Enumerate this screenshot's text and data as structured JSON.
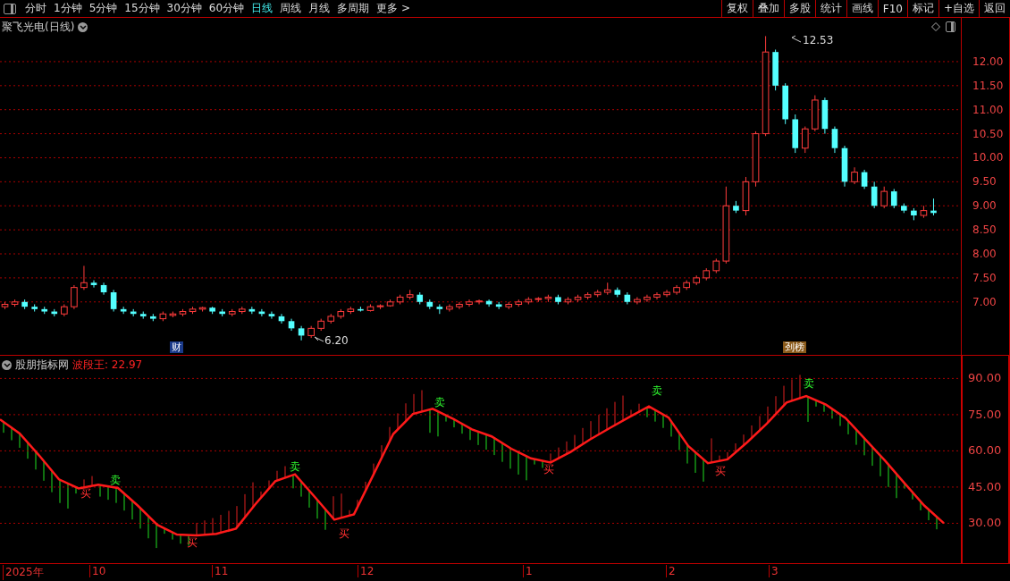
{
  "toolbar": {
    "periods": [
      {
        "label": "分时",
        "selected": false
      },
      {
        "label": "1分钟",
        "selected": false
      },
      {
        "label": "5分钟",
        "selected": false
      },
      {
        "label": "15分钟",
        "selected": false
      },
      {
        "label": "30分钟",
        "selected": false
      },
      {
        "label": "60分钟",
        "selected": false
      },
      {
        "label": "日线",
        "selected": true
      },
      {
        "label": "周线",
        "selected": false
      },
      {
        "label": "月线",
        "selected": false
      },
      {
        "label": "多周期",
        "selected": false
      },
      {
        "label": "更多 >",
        "selected": false
      }
    ],
    "buttons": [
      "复权",
      "叠加",
      "多股",
      "统计",
      "画线",
      "F10",
      "标记",
      "+自选",
      "返回"
    ]
  },
  "main_chart": {
    "title": "聚飞光电(日线)",
    "high_label": "12.53",
    "low_label": "6.20",
    "badges": [
      {
        "text": "财",
        "color": "#1a3a8a"
      },
      {
        "text": "刭榜",
        "color": "#8a5a1a"
      }
    ],
    "chart_data": {
      "type": "candlestick",
      "grid": true,
      "ylim": [
        5.88,
        12.91
      ],
      "yticks": [
        {
          "value": 12,
          "label": "12.00"
        },
        {
          "value": 11.5,
          "label": "11.50"
        },
        {
          "value": 11,
          "label": "11.00"
        },
        {
          "value": 10.5,
          "label": "10.50"
        },
        {
          "value": 10,
          "label": "10.00"
        },
        {
          "value": 9.5,
          "label": "9.50"
        },
        {
          "value": 9,
          "label": "9.00"
        },
        {
          "value": 8.5,
          "label": "8.50"
        },
        {
          "value": 8,
          "label": "8.00"
        },
        {
          "value": 7.5,
          "label": "7.50"
        },
        {
          "value": 7,
          "label": "7.00"
        }
      ],
      "ohlc": [
        [
          6.9,
          7.0,
          6.85,
          6.95
        ],
        [
          6.95,
          7.05,
          6.9,
          7.0
        ],
        [
          7.0,
          7.05,
          6.85,
          6.9
        ],
        [
          6.9,
          6.95,
          6.8,
          6.85
        ],
        [
          6.85,
          6.9,
          6.75,
          6.8
        ],
        [
          6.8,
          6.85,
          6.7,
          6.75
        ],
        [
          6.75,
          6.95,
          6.7,
          6.9
        ],
        [
          6.9,
          7.35,
          6.85,
          7.3
        ],
        [
          7.3,
          7.75,
          7.25,
          7.4
        ],
        [
          7.4,
          7.45,
          7.3,
          7.35
        ],
        [
          7.35,
          7.4,
          7.15,
          7.2
        ],
        [
          7.2,
          7.25,
          6.8,
          6.85
        ],
        [
          6.85,
          6.9,
          6.75,
          6.8
        ],
        [
          6.8,
          6.85,
          6.7,
          6.75
        ],
        [
          6.75,
          6.8,
          6.65,
          6.7
        ],
        [
          6.7,
          6.75,
          6.6,
          6.65
        ],
        [
          6.65,
          6.8,
          6.6,
          6.75
        ],
        [
          6.72,
          6.8,
          6.68,
          6.75
        ],
        [
          6.75,
          6.85,
          6.7,
          6.8
        ],
        [
          6.8,
          6.9,
          6.75,
          6.85
        ],
        [
          6.85,
          6.9,
          6.8,
          6.88
        ],
        [
          6.88,
          6.9,
          6.75,
          6.8
        ],
        [
          6.8,
          6.85,
          6.7,
          6.75
        ],
        [
          6.75,
          6.85,
          6.7,
          6.8
        ],
        [
          6.8,
          6.9,
          6.75,
          6.85
        ],
        [
          6.85,
          6.9,
          6.75,
          6.8
        ],
        [
          6.8,
          6.85,
          6.7,
          6.75
        ],
        [
          6.75,
          6.8,
          6.65,
          6.7
        ],
        [
          6.7,
          6.75,
          6.55,
          6.6
        ],
        [
          6.6,
          6.65,
          6.4,
          6.45
        ],
        [
          6.45,
          6.5,
          6.2,
          6.3
        ],
        [
          6.3,
          6.5,
          6.25,
          6.45
        ],
        [
          6.45,
          6.65,
          6.4,
          6.6
        ],
        [
          6.6,
          6.75,
          6.55,
          6.7
        ],
        [
          6.7,
          6.85,
          6.65,
          6.8
        ],
        [
          6.8,
          6.9,
          6.75,
          6.85
        ],
        [
          6.85,
          6.9,
          6.8,
          6.82
        ],
        [
          6.82,
          6.95,
          6.8,
          6.9
        ],
        [
          6.9,
          6.95,
          6.85,
          6.92
        ],
        [
          6.92,
          7.05,
          6.9,
          7.0
        ],
        [
          7.0,
          7.15,
          6.95,
          7.1
        ],
        [
          7.1,
          7.25,
          7.05,
          7.15
        ],
        [
          7.15,
          7.2,
          6.95,
          7.0
        ],
        [
          7.0,
          7.05,
          6.85,
          6.9
        ],
        [
          6.9,
          6.95,
          6.75,
          6.85
        ],
        [
          6.85,
          6.95,
          6.8,
          6.9
        ],
        [
          6.9,
          7.0,
          6.85,
          6.95
        ],
        [
          6.95,
          7.05,
          6.9,
          7.0
        ],
        [
          7.0,
          7.05,
          6.95,
          7.02
        ],
        [
          7.02,
          7.05,
          6.9,
          6.95
        ],
        [
          6.95,
          7.0,
          6.85,
          6.9
        ],
        [
          6.9,
          7.0,
          6.85,
          6.95
        ],
        [
          6.95,
          7.05,
          6.9,
          7.0
        ],
        [
          7.0,
          7.1,
          6.95,
          7.05
        ],
        [
          7.05,
          7.1,
          7.0,
          7.07
        ],
        [
          7.07,
          7.15,
          7.0,
          7.1
        ],
        [
          7.1,
          7.15,
          6.95,
          7.0
        ],
        [
          7.0,
          7.1,
          6.95,
          7.05
        ],
        [
          7.05,
          7.15,
          7.0,
          7.1
        ],
        [
          7.1,
          7.2,
          7.05,
          7.15
        ],
        [
          7.15,
          7.25,
          7.1,
          7.2
        ],
        [
          7.2,
          7.4,
          7.15,
          7.25
        ],
        [
          7.25,
          7.3,
          7.1,
          7.15
        ],
        [
          7.15,
          7.2,
          6.95,
          7.0
        ],
        [
          7.0,
          7.1,
          6.95,
          7.05
        ],
        [
          7.05,
          7.15,
          7.0,
          7.1
        ],
        [
          7.1,
          7.2,
          7.05,
          7.15
        ],
        [
          7.15,
          7.25,
          7.1,
          7.2
        ],
        [
          7.2,
          7.35,
          7.15,
          7.3
        ],
        [
          7.3,
          7.45,
          7.25,
          7.4
        ],
        [
          7.4,
          7.55,
          7.35,
          7.5
        ],
        [
          7.5,
          7.7,
          7.45,
          7.65
        ],
        [
          7.65,
          7.9,
          7.6,
          7.85
        ],
        [
          7.85,
          9.4,
          7.8,
          9.0
        ],
        [
          9.0,
          9.1,
          8.85,
          8.9
        ],
        [
          8.9,
          9.6,
          8.8,
          9.5
        ],
        [
          9.5,
          10.55,
          9.4,
          10.5
        ],
        [
          10.5,
          12.53,
          10.45,
          12.2
        ],
        [
          12.2,
          12.25,
          11.4,
          11.5
        ],
        [
          11.5,
          11.55,
          10.7,
          10.8
        ],
        [
          10.8,
          10.9,
          10.1,
          10.2
        ],
        [
          10.2,
          10.65,
          10.1,
          10.6
        ],
        [
          10.6,
          11.3,
          10.55,
          11.2
        ],
        [
          11.2,
          11.25,
          10.5,
          10.6
        ],
        [
          10.6,
          10.65,
          10.1,
          10.2
        ],
        [
          10.2,
          10.25,
          9.4,
          9.5
        ],
        [
          9.5,
          9.8,
          9.45,
          9.7
        ],
        [
          9.7,
          9.75,
          9.35,
          9.4
        ],
        [
          9.4,
          9.5,
          8.95,
          9.0
        ],
        [
          9.0,
          9.4,
          8.95,
          9.3
        ],
        [
          9.3,
          9.35,
          8.95,
          9.0
        ],
        [
          9.0,
          9.05,
          8.85,
          8.9
        ],
        [
          8.9,
          8.95,
          8.7,
          8.8
        ],
        [
          8.8,
          9.0,
          8.75,
          8.9
        ],
        [
          8.9,
          9.15,
          8.8,
          8.85
        ]
      ]
    }
  },
  "indicator": {
    "name": "股朋指标网",
    "value_label": "波段王: 22.97",
    "chart_data": {
      "type": "line",
      "grid": true,
      "ylim": [
        13.5,
        99.4
      ],
      "yticks": [
        {
          "value": 90,
          "label": "90.00"
        },
        {
          "value": 75,
          "label": "75.00"
        },
        {
          "value": 60,
          "label": "60.00"
        },
        {
          "value": 45,
          "label": "45.00"
        },
        {
          "value": 30,
          "label": "30.00"
        }
      ],
      "series": [
        {
          "color": "#ff1a1a",
          "values": [
            73,
            67.2,
            58,
            48.2,
            44.4,
            46,
            44.6,
            37.4,
            29.4,
            25.3,
            25,
            25.6,
            27.8,
            38,
            47.4,
            50.3,
            41,
            31.5,
            33.7,
            50.3,
            67,
            75.3,
            77.4,
            73.5,
            68.9,
            66,
            60.9,
            56.9,
            55.2,
            59.5,
            64.7,
            69.4,
            74,
            78.4,
            73.8,
            62,
            54.9,
            56.5,
            63.6,
            71.3,
            80,
            82.7,
            79.2,
            73.6,
            64.8,
            56,
            46.6,
            37.4,
            30
          ]
        }
      ]
    },
    "signals": [
      {
        "kind": "buy",
        "text": "买"
      },
      {
        "kind": "sell",
        "text": "卖"
      },
      {
        "kind": "buy",
        "text": "买"
      },
      {
        "kind": "sell",
        "text": "卖"
      },
      {
        "kind": "buy",
        "text": "买"
      },
      {
        "kind": "sell",
        "text": "卖"
      },
      {
        "kind": "buy",
        "text": "买"
      },
      {
        "kind": "sell",
        "text": "卖"
      },
      {
        "kind": "buy",
        "text": "买"
      },
      {
        "kind": "sell",
        "text": "卖"
      }
    ]
  },
  "time_axis": [
    "2025年",
    "10",
    "11",
    "12",
    "1",
    "2",
    "3"
  ]
}
